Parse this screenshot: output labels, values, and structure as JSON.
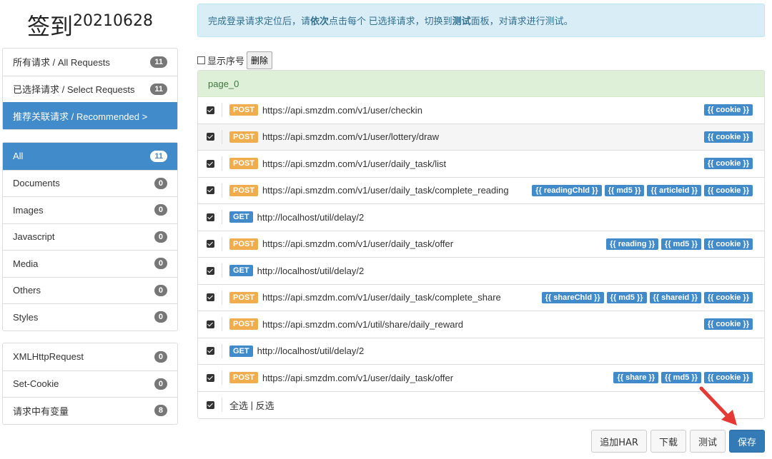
{
  "title": {
    "main": "签到",
    "sup": "20210628"
  },
  "alert": {
    "prefix": "完成登录请求定位后，请",
    "bold1": "依次",
    "mid": "点击每个 已选择请求，切换到 ",
    "bold2": "测试",
    "suffix": " 面板，对请求进行测试。"
  },
  "sidebar": {
    "group1": [
      {
        "label": "所有请求 / All Requests",
        "count": "11",
        "active": false
      },
      {
        "label": "已选择请求 / Select Requests",
        "count": "11",
        "active": false
      },
      {
        "label": "推荐关联请求 / Recommended >",
        "count": "",
        "active": true
      }
    ],
    "group2": [
      {
        "label": "All",
        "count": "11",
        "active": true
      },
      {
        "label": "Documents",
        "count": "0",
        "active": false
      },
      {
        "label": "Images",
        "count": "0",
        "active": false
      },
      {
        "label": "Javascript",
        "count": "0",
        "active": false
      },
      {
        "label": "Media",
        "count": "0",
        "active": false
      },
      {
        "label": "Others",
        "count": "0",
        "active": false
      },
      {
        "label": "Styles",
        "count": "0",
        "active": false
      }
    ],
    "group3": [
      {
        "label": "XMLHttpRequest",
        "count": "0",
        "active": false
      },
      {
        "label": "Set-Cookie",
        "count": "0",
        "active": false
      },
      {
        "label": "请求中有变量",
        "count": "8",
        "active": false
      }
    ]
  },
  "toolbar": {
    "show_index_label": "显示序号",
    "delete_label": "删除"
  },
  "panel": {
    "heading": "page_0",
    "footer_select_all": "全选",
    "footer_sep": " | ",
    "footer_invert": "反选"
  },
  "requests": [
    {
      "method": "POST",
      "url": "https://api.smzdm.com/v1/user/checkin",
      "tags": [
        "{{ cookie }}"
      ]
    },
    {
      "method": "POST",
      "url": "https://api.smzdm.com/v1/user/lottery/draw",
      "tags": [
        "{{ cookie }}"
      ]
    },
    {
      "method": "POST",
      "url": "https://api.smzdm.com/v1/user/daily_task/list",
      "tags": [
        "{{ cookie }}"
      ]
    },
    {
      "method": "POST",
      "url": "https://api.smzdm.com/v1/user/daily_task/complete_reading",
      "tags": [
        "{{ readingChld }}",
        "{{ md5 }}",
        "{{ articleid }}",
        "{{ cookie }}"
      ]
    },
    {
      "method": "GET",
      "url": "http://localhost/util/delay/2",
      "tags": []
    },
    {
      "method": "POST",
      "url": "https://api.smzdm.com/v1/user/daily_task/offer",
      "tags": [
        "{{ reading }}",
        "{{ md5 }}",
        "{{ cookie }}"
      ]
    },
    {
      "method": "GET",
      "url": "http://localhost/util/delay/2",
      "tags": []
    },
    {
      "method": "POST",
      "url": "https://api.smzdm.com/v1/user/daily_task/complete_share",
      "tags": [
        "{{ shareChld }}",
        "{{ md5 }}",
        "{{ shareid }}",
        "{{ cookie }}"
      ]
    },
    {
      "method": "POST",
      "url": "https://api.smzdm.com/v1/util/share/daily_reward",
      "tags": [
        "{{ cookie }}"
      ]
    },
    {
      "method": "GET",
      "url": "http://localhost/util/delay/2",
      "tags": []
    },
    {
      "method": "POST",
      "url": "https://api.smzdm.com/v1/user/daily_task/offer",
      "tags": [
        "{{ share }}",
        "{{ md5 }}",
        "{{ cookie }}"
      ]
    }
  ],
  "actions": {
    "append_har": "追加HAR",
    "download": "下载",
    "test": "测试",
    "save": "保存"
  },
  "colors": {
    "primary": "#337ab7",
    "post": "#f0ad4e",
    "get": "#428bca",
    "arrow": "#e53935"
  }
}
